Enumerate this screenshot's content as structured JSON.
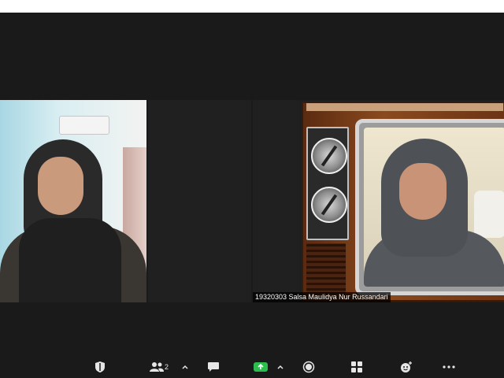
{
  "window": {
    "participant_label": "19320303 Salsa Maulidya Nur Russandari"
  },
  "toolbar": {
    "participants_count": "2",
    "icons": [
      "shield-icon",
      "participants-icon",
      "chevron-up-icon",
      "chat-icon",
      "share-screen-icon",
      "chevron-up-icon",
      "record-icon",
      "apps-icon",
      "reactions-icon",
      "more-icon"
    ]
  },
  "colors": {
    "background": "#1a1a1a",
    "share_green": "#2dbc4e",
    "icon": "#e6e6e6"
  }
}
